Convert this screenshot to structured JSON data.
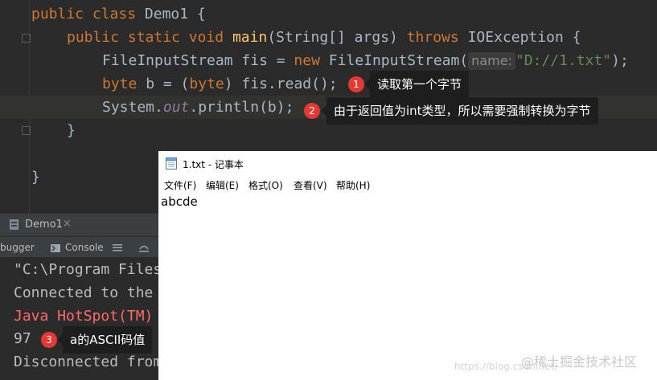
{
  "editor": {
    "lines": [
      {
        "l1": "public",
        "l2": "class",
        "l3": "Demo1 {"
      },
      {
        "kw1": "public",
        "kw2": "static",
        "kw3": "void",
        "fn": "main",
        "p1": "(String[] args) ",
        "kw4": "throws",
        "p2": " IOException {"
      },
      {
        "t1": "FileInputStream fis = ",
        "kw": "new",
        "t2": " FileInputStream(",
        "hint": "name:",
        "str": "\"D://1.txt\"",
        "t3": ");"
      },
      {
        "kw1": "byte",
        "t1": " b = (",
        "kw2": "byte",
        "t2": ") fis.read();"
      },
      {
        "t1": "System.",
        "field": "out",
        "t2": ".println(b);"
      },
      {
        "t": "}"
      },
      {
        "t": "}"
      }
    ]
  },
  "annotations": [
    {
      "num": "1",
      "text": "读取第一个字节"
    },
    {
      "num": "2",
      "text": "由于返回值为int类型，所以需要强制转换为字节"
    },
    {
      "num": "3",
      "text": "a的ASCII码值"
    }
  ],
  "run_panel": {
    "tab_label": "Demo1",
    "close_glyph": "×",
    "debugger_label": "bugger",
    "console_label": "Console"
  },
  "console": {
    "lines": [
      "\"C:\\Program Files",
      "Connected to the",
      "Java HotSpot(TM)",
      "97",
      "Disconnected from"
    ],
    "error_color": "#ff6b68"
  },
  "notepad": {
    "title": "1.txt - 记事本",
    "menu": [
      "文件(F)",
      "编辑(E)",
      "格式(O)",
      "查看(V)",
      "帮助(H)"
    ],
    "content": "abcde"
  },
  "watermarks": {
    "url": "https://blog.csdn.net/",
    "site": "@稀土掘金技术社区"
  }
}
